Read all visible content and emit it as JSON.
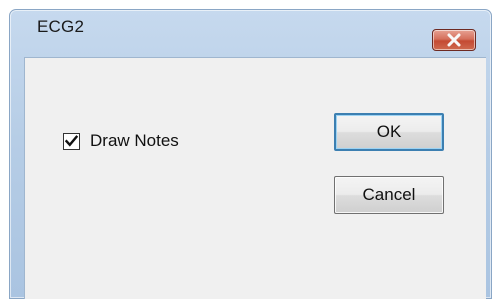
{
  "dialog": {
    "title": "ECG2",
    "close_icon": "close-x-icon",
    "checkbox": {
      "label": "Draw Notes",
      "checked": true
    },
    "buttons": {
      "ok_label": "OK",
      "cancel_label": "Cancel"
    }
  },
  "colors": {
    "titlebar": "#b6cde6",
    "client_background": "#f0f0f0",
    "close_button": "#c44a33",
    "default_button_border": "#3c7fb1"
  }
}
